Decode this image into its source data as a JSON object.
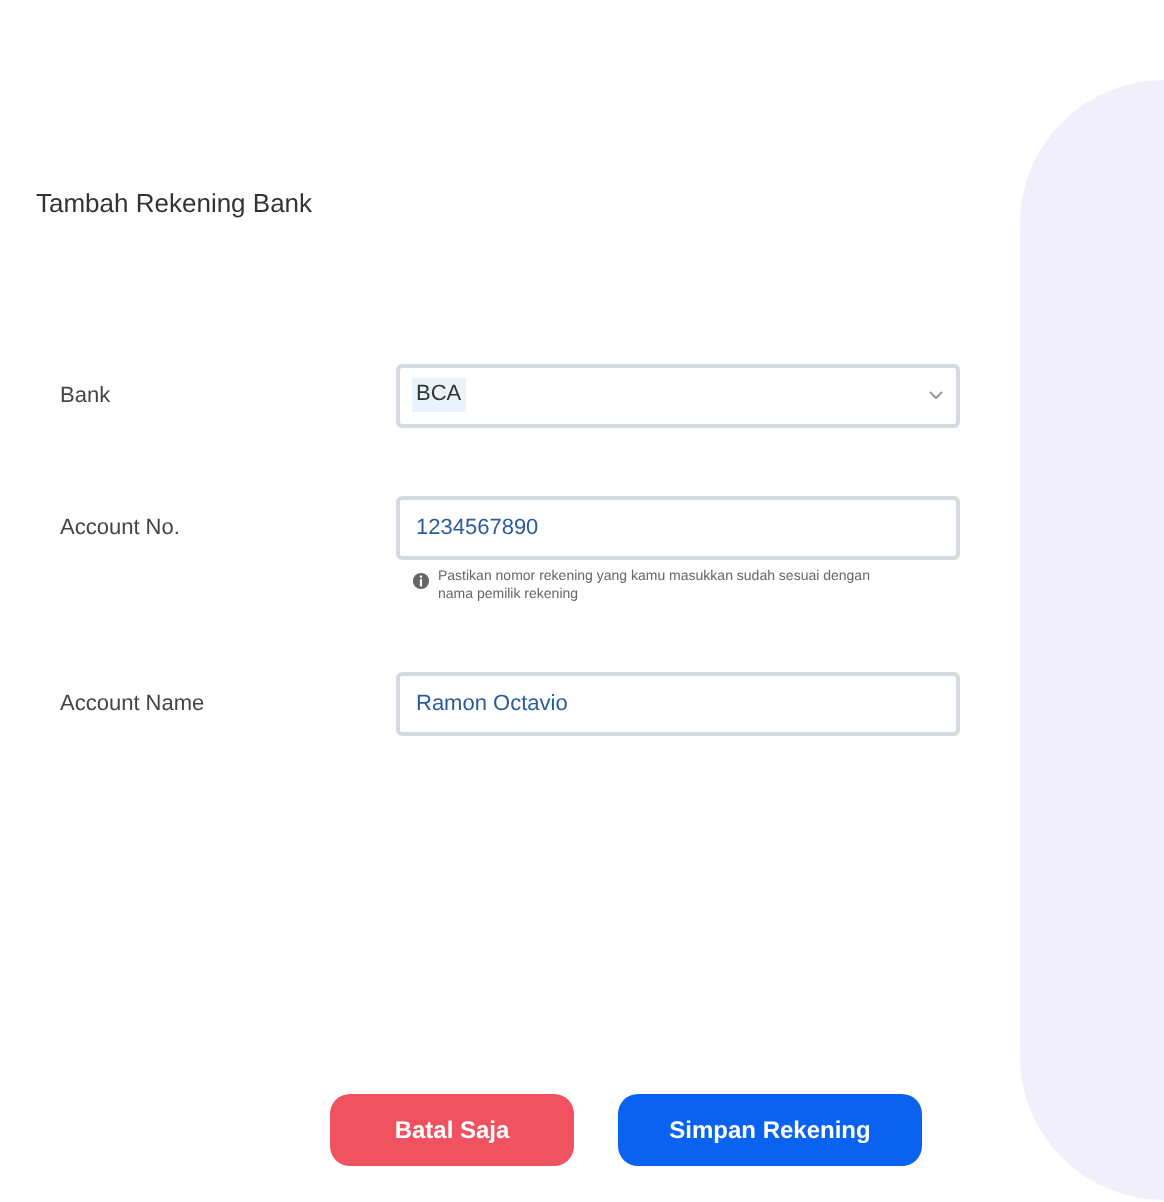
{
  "title": "Tambah Rekening Bank",
  "fields": [
    {
      "kind": "select",
      "label": "Bank",
      "value": "BCA"
    },
    {
      "kind": "text",
      "label": "Account No.",
      "value": "1234567890",
      "hint": "Pastikan nomor rekening yang kamu masukkan sudah sesuai dengan nama pemilik rekening"
    },
    {
      "kind": "text",
      "label": "Account Name",
      "value": "Ramon Octavio"
    }
  ],
  "buttons": [
    {
      "label": "Batal Saja",
      "kind": "danger"
    },
    {
      "label": "Simpan Rekening",
      "kind": "primary"
    }
  ]
}
